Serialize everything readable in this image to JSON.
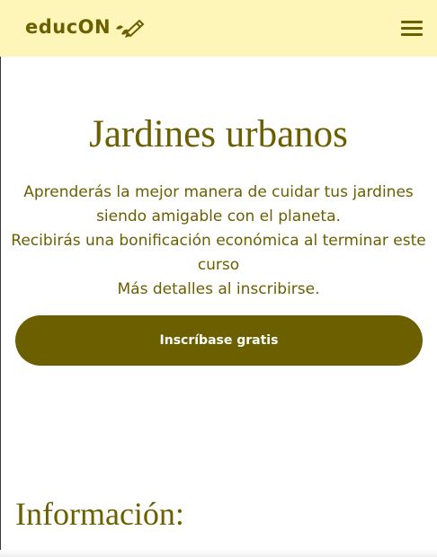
{
  "header": {
    "logo_text": "educON",
    "logo_icon": "pencil-leaf-icon",
    "menu_icon": "hamburger-menu-icon"
  },
  "hero": {
    "title": "Jardines urbanos",
    "description_lines": [
      "Aprenderás la mejor manera de cuidar tus jardines",
      "siendo amigable con el planeta.",
      "Recibirás una bonificación económica al terminar este",
      "curso",
      "Más detalles al inscribirse."
    ],
    "cta_label": "Inscríbase gratis"
  },
  "info": {
    "title": "Información:"
  },
  "colors": {
    "header_bg": "#fdf6b8",
    "brand": "#6b5f00",
    "button_text": "#ffffff"
  }
}
